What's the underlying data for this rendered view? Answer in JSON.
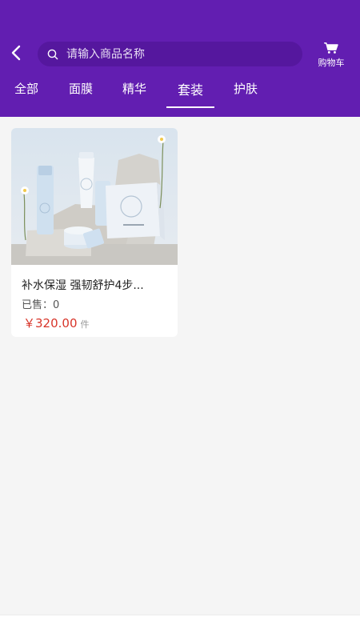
{
  "header": {
    "search_placeholder": "请输入商品名称",
    "cart_label": "购物车"
  },
  "tabs": [
    {
      "label": "全部",
      "active": false
    },
    {
      "label": "面膜",
      "active": false
    },
    {
      "label": "精华",
      "active": false
    },
    {
      "label": "套装",
      "active": true
    },
    {
      "label": "护肤",
      "active": false
    }
  ],
  "products": [
    {
      "title": "补水保湿 强韧舒护4步...",
      "sold_label": "已售：",
      "sold_count": "0",
      "currency": "￥",
      "price": "320.00",
      "unit": "件"
    }
  ],
  "colors": {
    "header_bg": "#621eb1",
    "price_red": "#d8352a"
  }
}
